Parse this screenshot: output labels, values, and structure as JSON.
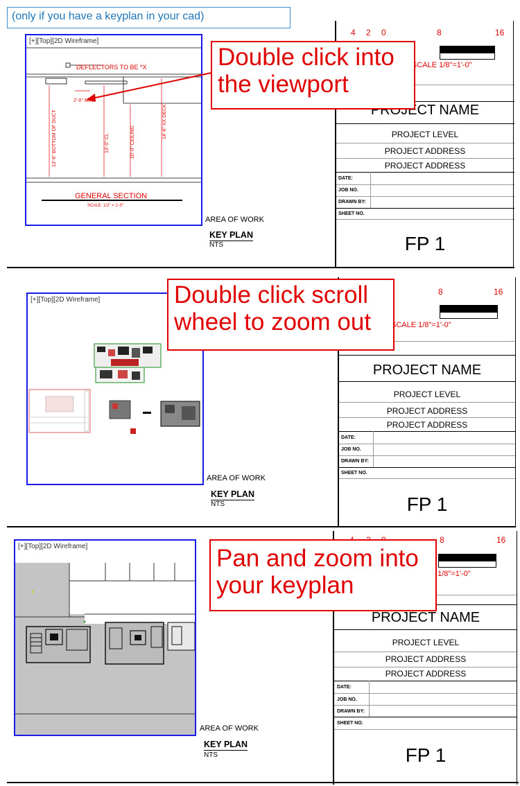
{
  "note": "(only if you have a keyplan in your cad)",
  "viewport_label": "[+][Top][2D Wireframe]",
  "steps": [
    {
      "instruction": "Double click into the viewport"
    },
    {
      "instruction": "Double click scroll wheel to zoom out"
    },
    {
      "instruction": "Pan and zoom into your keyplan"
    }
  ],
  "keyplan": {
    "area_label": "AREA OF WORK",
    "title": "KEY PLAN",
    "scale": "NTS"
  },
  "title_block": {
    "scale_ticks": [
      "4",
      "2",
      "0",
      "8",
      "16"
    ],
    "scale_text": "SCALE 1/8\"=1'-0\"",
    "project_name": "PROJECT NAME",
    "project_level": "PROJECT LEVEL",
    "project_address_1": "PROJECT ADDRESS",
    "project_address_2": "PROJECT ADDRESS",
    "date_label": "DATE:",
    "job_label": "JOB NO.",
    "drawn_label": "DRAWN BY:",
    "sheet_label": "SHEET NO.",
    "sheet_number": "FP 1"
  },
  "section_drawing": {
    "note": "DEFLECTORS TO BE *X",
    "dims": [
      "2'-0\" MIN",
      "13'-6\" BOTTOM OF DUCT",
      "13'-0\" CL",
      "10'-0\" CEILING",
      "14'-6\" XX DECK"
    ],
    "title": "GENERAL SECTION",
    "scale": "SCALE: 1/2\" = 1'-0\""
  },
  "colors": {
    "accent_red": "#e00000",
    "viewport_blue": "#1a1ae6",
    "note_blue": "#1f76b8"
  }
}
